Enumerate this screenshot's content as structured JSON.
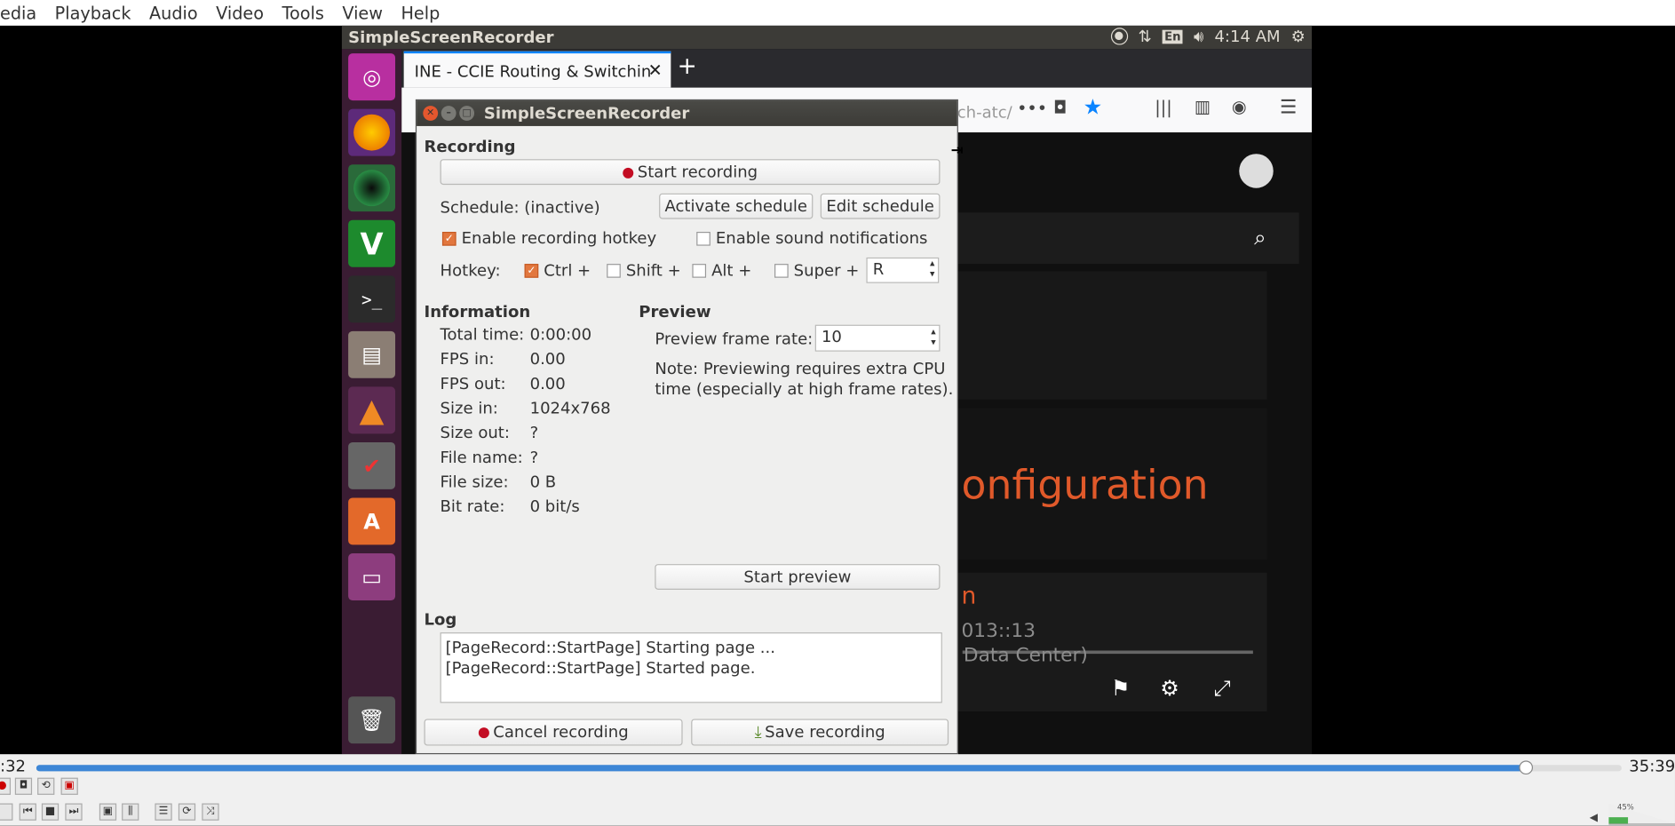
{
  "vlc_menu": [
    "edia",
    "Playback",
    "Audio",
    "Video",
    "Tools",
    "View",
    "Help"
  ],
  "ubuntu_bar": {
    "title": "SimpleScreenRecorder",
    "lang": "En",
    "time": "4:14 AM"
  },
  "browser": {
    "tab_title": "INE - CCIE Routing & Switchin",
    "tab_close": "✕",
    "new_tab": "+",
    "url_fragment": "ch-atc/"
  },
  "ssr": {
    "title": "SimpleScreenRecorder",
    "recording_label": "Recording",
    "start_recording": "Start recording",
    "schedule_text": "Schedule: (inactive)",
    "activate_schedule": "Activate schedule",
    "edit_schedule": "Edit schedule",
    "enable_hotkey": "Enable recording hotkey",
    "enable_sound": "Enable sound notifications",
    "hotkey_label": "Hotkey:",
    "ctrl": "Ctrl +",
    "shift": "Shift +",
    "alt": "Alt +",
    "super": "Super +",
    "hotkey_key": "R",
    "information_label": "Information",
    "info": [
      {
        "k": "Total time:",
        "v": "0:00:00"
      },
      {
        "k": "FPS in:",
        "v": "0.00"
      },
      {
        "k": "FPS out:",
        "v": "0.00"
      },
      {
        "k": "Size in:",
        "v": "1024x768"
      },
      {
        "k": "Size out:",
        "v": "?"
      },
      {
        "k": "File name:",
        "v": "?"
      },
      {
        "k": "File size:",
        "v": "0 B"
      },
      {
        "k": "Bit rate:",
        "v": "0 bit/s"
      }
    ],
    "preview_label": "Preview",
    "preview_rate_label": "Preview frame rate:",
    "preview_rate": "10",
    "note1": "Note: Previewing requires extra CPU",
    "note2": "time (especially at high frame rates).",
    "start_preview": "Start preview",
    "log_label": "Log",
    "log": [
      "[PageRecord::StartPage] Starting page ...",
      "[PageRecord::StartPage] Started page."
    ],
    "cancel_recording": "Cancel recording",
    "save_recording": "Save recording"
  },
  "site": {
    "heading": "onfiguration",
    "link_frag": "n",
    "timestamp": "013::13",
    "subtitle": "Data Center)"
  },
  "vlc": {
    "elapsed": ":32",
    "total": "35:39",
    "volume": "45%",
    "progress": 0.94
  }
}
